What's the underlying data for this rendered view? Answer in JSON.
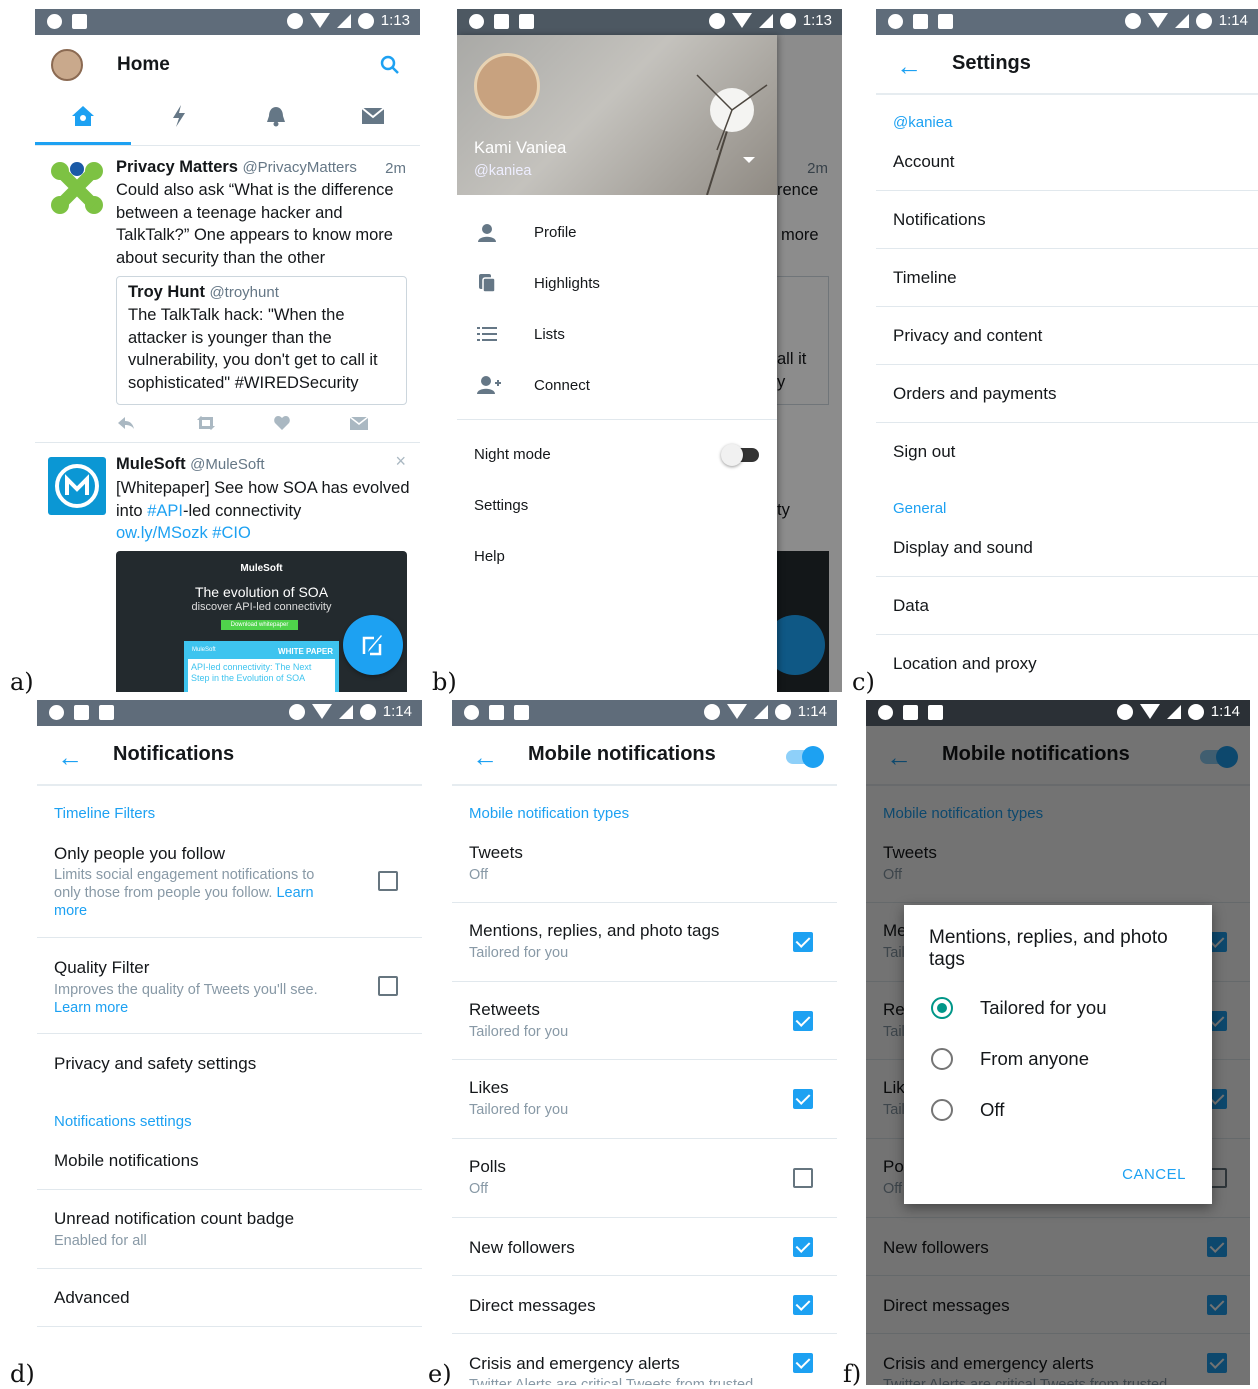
{
  "labels": {
    "a": "a)",
    "b": "b)",
    "c": "c)",
    "d": "d)",
    "e": "e)",
    "f": "f)"
  },
  "status_times": {
    "a": "1:13",
    "b": "1:13",
    "c": "1:14",
    "d": "1:14",
    "e": "1:14",
    "f": "1:14"
  },
  "panel_a": {
    "title": "Home",
    "tweet1": {
      "name": "Privacy Matters",
      "handle": "@PrivacyMatters",
      "time": "2m",
      "text": "Could also ask “What is the difference between a teenage hacker and TalkTalk?” One appears to know more about security than the other",
      "quote_name": "Troy Hunt",
      "quote_handle": "@troyhunt",
      "quote_text": "The TalkTalk hack: \"When the attacker is younger than the vulnerability, you don't get to call it sophisticated\" #WIREDSecurity"
    },
    "tweet2": {
      "name": "MuleSoft",
      "handle": "@MuleSoft",
      "text_before": "[Whitepaper] See how SOA has evolved into ",
      "hashtag": "#API",
      "text_after": "-led connectivity",
      "link": "ow.ly/MSozk #CIO",
      "card_brand": "MuleSoft",
      "card_title": "The evolution of SOA",
      "card_sub": "discover API-led connectivity",
      "card_btn": "Download whitepaper",
      "card_paper_brand": "MuleSoft",
      "card_paper_label": "WHITE PAPER",
      "card_paper_text": "API-led connectivity: The Next Step in the Evolution of SOA"
    },
    "colors": {
      "accent": "#1da1f2"
    }
  },
  "panel_b": {
    "user_name": "Kami Vaniea",
    "user_handle": "@kaniea",
    "menu": [
      "Profile",
      "Highlights",
      "Lists",
      "Connect"
    ],
    "night_mode": "Night mode",
    "night_mode_on": false,
    "settings": "Settings",
    "help": "Help",
    "behind_fragments": [
      "2m",
      "rence",
      "more",
      "all it",
      "y",
      "ty"
    ]
  },
  "panel_c": {
    "title": "Settings",
    "account_head": "@kaniea",
    "account_items": [
      "Account",
      "Notifications",
      "Timeline",
      "Privacy and content",
      "Orders and payments",
      "Sign out"
    ],
    "general_head": "General",
    "general_items": [
      "Display and sound",
      "Data",
      "Location and proxy"
    ]
  },
  "panel_d": {
    "title": "Notifications",
    "filters_head": "Timeline Filters",
    "only_people": {
      "title": "Only people you follow",
      "sub": "Limits social engagement notifications to only those from people you follow.",
      "link": "Learn more",
      "checked": false
    },
    "quality": {
      "title": "Quality Filter",
      "sub": "Improves the quality of Tweets you'll see.",
      "link": "Learn more",
      "checked": false
    },
    "privacy": "Privacy and safety settings",
    "settings_head": "Notifications settings",
    "mobile": "Mobile notifications",
    "badge": {
      "title": "Unread notification count badge",
      "sub": "Enabled for all"
    },
    "advanced": "Advanced"
  },
  "panel_e": {
    "title": "Mobile notifications",
    "master_toggle_on": true,
    "types_head": "Mobile notification types",
    "items": [
      {
        "title": "Tweets",
        "sub": "Off",
        "checkbox": null
      },
      {
        "title": "Mentions, replies, and photo tags",
        "sub": "Tailored for you",
        "checkbox": true
      },
      {
        "title": "Retweets",
        "sub": "Tailored for you",
        "checkbox": true
      },
      {
        "title": "Likes",
        "sub": "Tailored for you",
        "checkbox": true
      },
      {
        "title": "Polls",
        "sub": "Off",
        "checkbox": false
      },
      {
        "title": "New followers",
        "sub": "",
        "checkbox": true
      },
      {
        "title": "Direct messages",
        "sub": "",
        "checkbox": true
      },
      {
        "title": "Crisis and emergency alerts",
        "sub": "Twitter Alerts are critical Tweets from trusted",
        "checkbox": true
      }
    ]
  },
  "panel_f": {
    "dialog_title": "Mentions, replies, and photo tags",
    "options": [
      "Tailored for you",
      "From anyone",
      "Off"
    ],
    "selected": "Tailored for you",
    "cancel": "CANCEL",
    "behind_fragments": [
      "Me",
      "Tail",
      "Ret",
      "Tail",
      "Lik",
      "Tail",
      "Po",
      "Off"
    ]
  }
}
